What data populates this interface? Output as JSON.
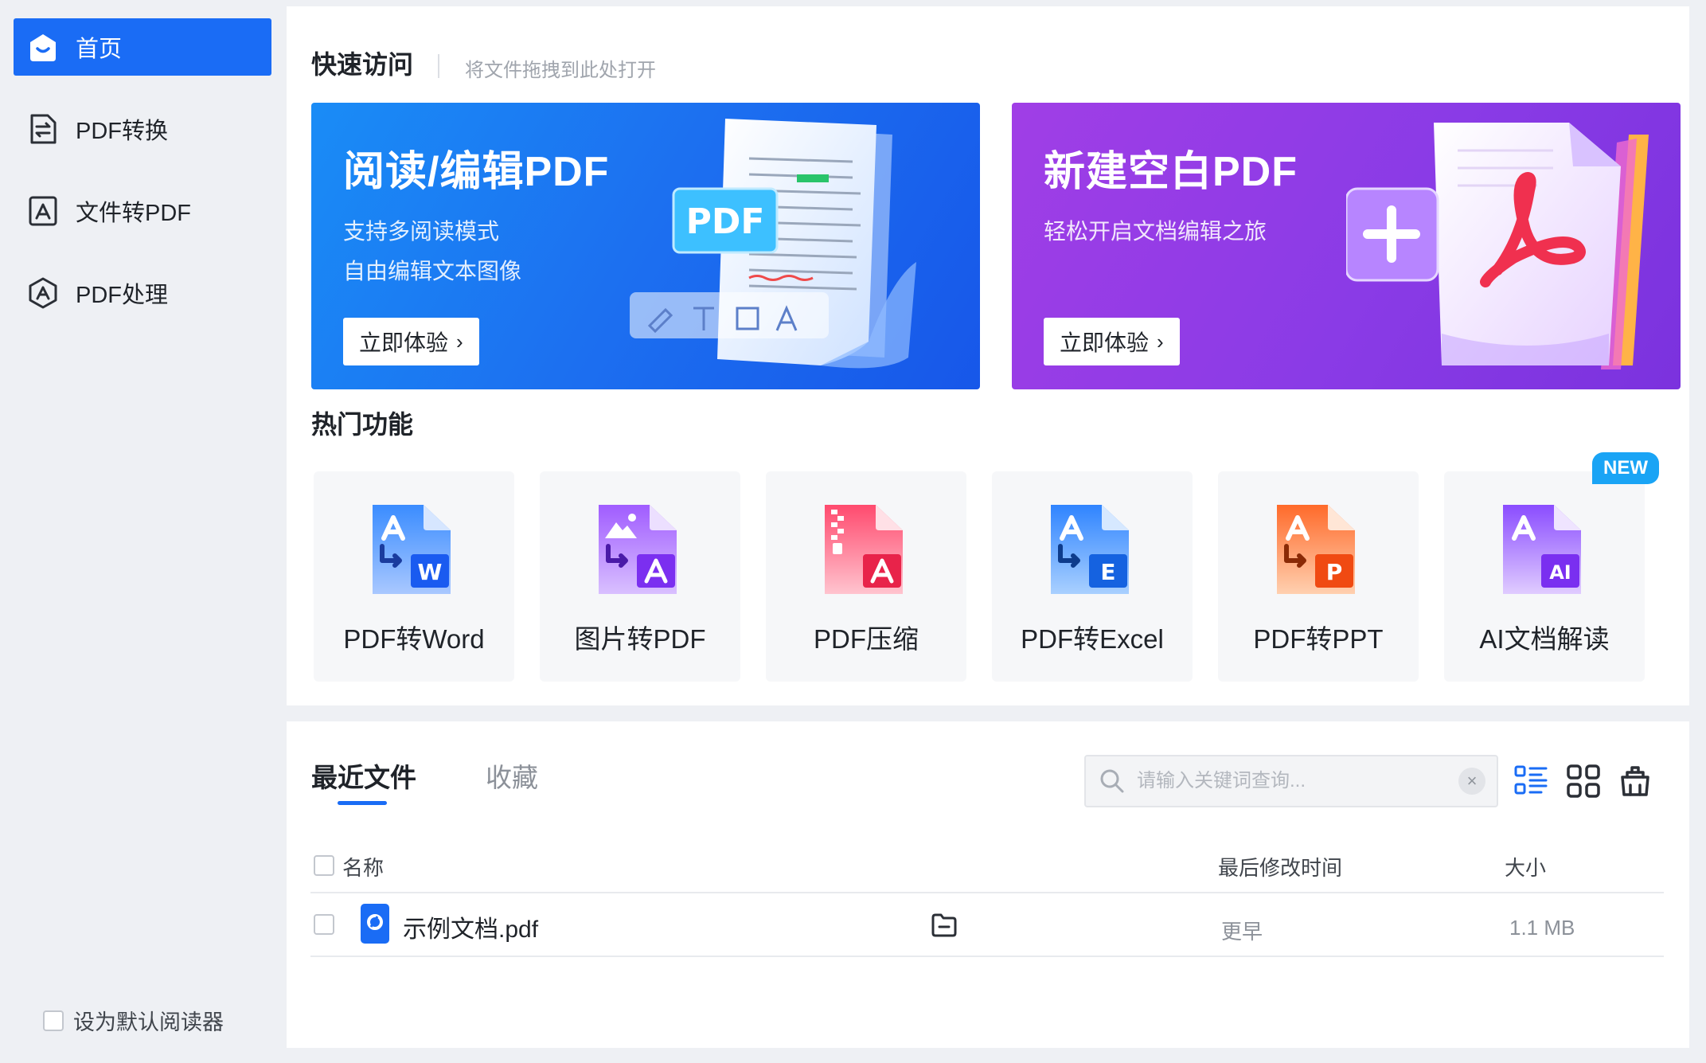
{
  "sidebar": {
    "items": [
      {
        "label": "首页",
        "icon": "home-icon"
      },
      {
        "label": "PDF转换",
        "icon": "pdf-convert-icon"
      },
      {
        "label": "文件转PDF",
        "icon": "file-to-pdf-icon"
      },
      {
        "label": "PDF处理",
        "icon": "pdf-process-icon"
      }
    ],
    "default_reader_label": "设为默认阅读器"
  },
  "quick_access": {
    "title": "快速访问",
    "hint": "将文件拖拽到此处打开",
    "banners": [
      {
        "title": "阅读/编辑PDF",
        "subtitle_1": "支持多阅读模式",
        "subtitle_2": "自由编辑文本图像",
        "button": "立即体验",
        "art_badge": "PDF"
      },
      {
        "title": "新建空白PDF",
        "subtitle_1": "轻松开启文档编辑之旅",
        "button": "立即体验"
      }
    ]
  },
  "hot_features": {
    "title": "热门功能",
    "new_badge": "NEW",
    "items": [
      {
        "label": "PDF转Word",
        "icon": "pdf-to-word-icon",
        "letter": "W"
      },
      {
        "label": "图片转PDF",
        "icon": "image-to-pdf-icon"
      },
      {
        "label": "PDF压缩",
        "icon": "pdf-compress-icon"
      },
      {
        "label": "PDF转Excel",
        "icon": "pdf-to-excel-icon",
        "letter": "E"
      },
      {
        "label": "PDF转PPT",
        "icon": "pdf-to-ppt-icon",
        "letter": "P"
      },
      {
        "label": "AI文档解读",
        "icon": "ai-doc-icon",
        "letter": "AI"
      }
    ]
  },
  "files": {
    "tabs": [
      "最近文件",
      "收藏"
    ],
    "search_placeholder": "请输入关键词查询...",
    "columns": {
      "name": "名称",
      "modified": "最后修改时间",
      "size": "大小"
    },
    "rows": [
      {
        "name": "示例文档.pdf",
        "modified": "更早",
        "size": "1.1 MB"
      }
    ]
  },
  "colors": {
    "accent": "#1a6cf5",
    "banner_blue": "#1c6ff0",
    "banner_purple": "#8a3be6",
    "badge": "#1aa4f5"
  }
}
